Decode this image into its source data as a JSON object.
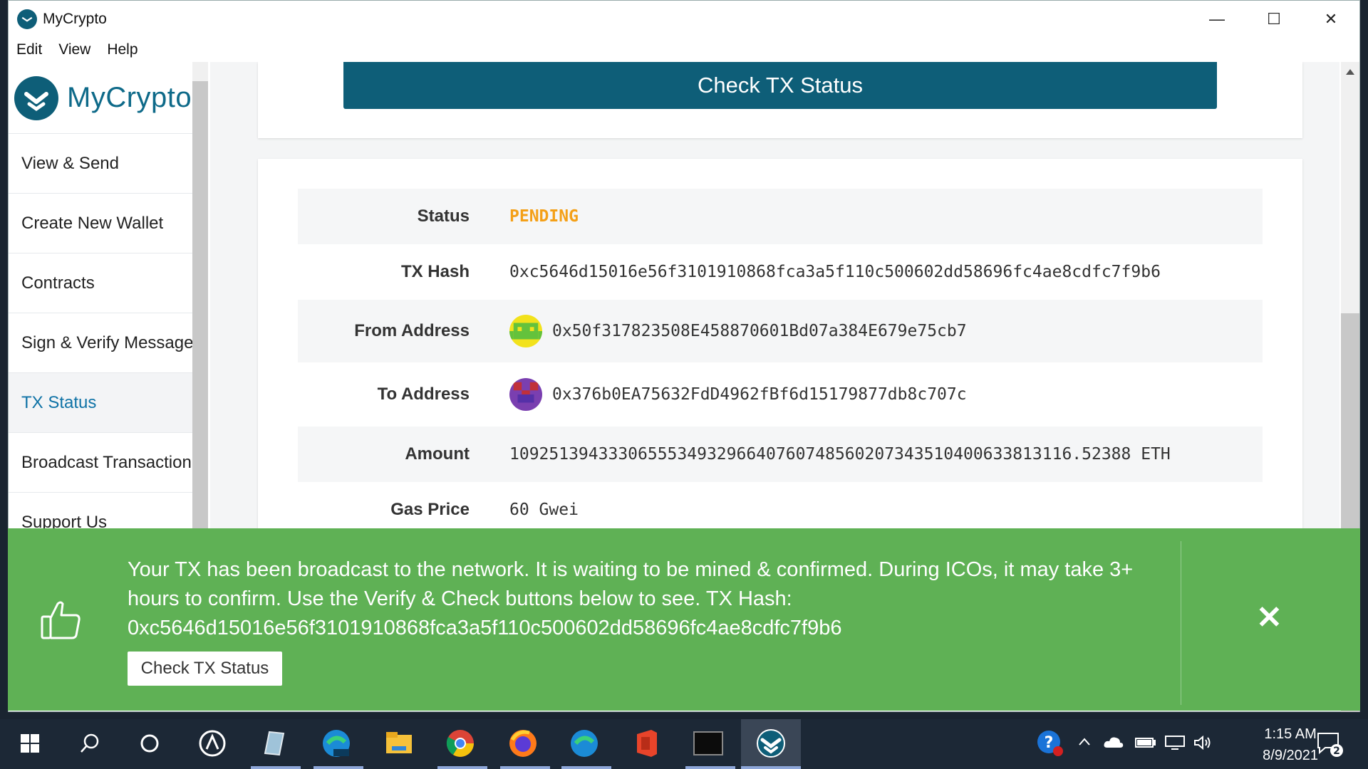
{
  "window": {
    "title": "MyCrypto",
    "minimize": "—",
    "maximize": "☐",
    "close": "✕"
  },
  "menu": [
    "Edit",
    "View",
    "Help"
  ],
  "sidebar": {
    "logo": "MyCrypto",
    "items": [
      {
        "label": "View & Send"
      },
      {
        "label": "Create New Wallet"
      },
      {
        "label": "Contracts"
      },
      {
        "label": "Sign & Verify Message"
      },
      {
        "label": "TX Status",
        "active": true
      },
      {
        "label": "Broadcast Transaction"
      },
      {
        "label": "Support Us"
      }
    ]
  },
  "main": {
    "check_button": "Check TX Status",
    "details": [
      {
        "label": "Status",
        "value": "PENDING"
      },
      {
        "label": "TX Hash",
        "value": "0xc5646d15016e56f3101910868fca3a5f110c500602dd58696fc4ae8cdfc7f9b6"
      },
      {
        "label": "From Address",
        "value": "0x50f317823508E458870601Bd07a384E679e75cb7"
      },
      {
        "label": "To Address",
        "value": "0x376b0EA75632FdD4962fBf6d15179877db8c707c"
      },
      {
        "label": "Amount",
        "value": "109251394333065553493296640760748560207343510400633813116.52388 ETH"
      },
      {
        "label": "Gas Price",
        "value": "60 Gwei"
      }
    ]
  },
  "notification": {
    "message_line1": "Your TX has been broadcast to the network. It is waiting to be mined & confirmed. During ICOs, it may take 3+",
    "message_line2": "hours to confirm. Use the Verify & Check buttons below to see. TX Hash:",
    "message_line3": "0xc5646d15016e56f3101910868fca3a5f110c500602dd58696fc4ae8cdfc7f9b6",
    "button": "Check TX Status",
    "close": "✕"
  },
  "taskbar": {
    "time": "1:15 AM",
    "date": "8/9/2021",
    "notification_count": "2"
  },
  "colors": {
    "accent": "#0e5e78",
    "pending": "#f4a018",
    "success": "#5fb155"
  }
}
